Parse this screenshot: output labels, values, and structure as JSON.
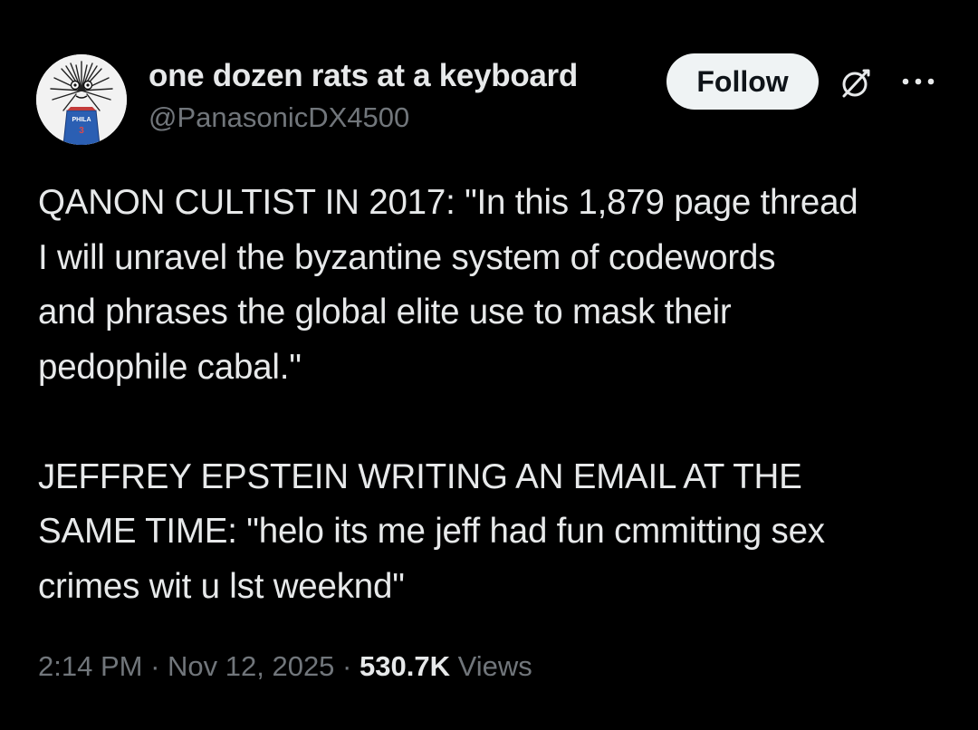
{
  "author": {
    "display_name": "one dozen rats at a keyboard",
    "handle": "@PanasonicDX4500",
    "avatar_icon": "hairy-creature-avatar",
    "avatar_jersey_text": "PHILA"
  },
  "actions": {
    "follow_label": "Follow",
    "grok_icon": "grok-icon",
    "more_icon": "more-dots-icon"
  },
  "tweet": {
    "text": "QANON CULTIST IN 2017: \"In this 1,879 page thread\nI will unravel the byzantine system of codewords\nand phrases the global elite use to mask their\npedophile cabal.\"\n\nJEFFREY EPSTEIN WRITING AN EMAIL AT THE\nSAME TIME: \"helo its me jeff had fun cmmitting sex\ncrimes wit u lst weeknd\""
  },
  "meta": {
    "time": "2:14 PM",
    "separator": " · ",
    "date": "Nov 12, 2025",
    "views_count": "530.7K",
    "views_label": " Views"
  },
  "colors": {
    "background": "#000000",
    "text_primary": "#e7e9ea",
    "text_secondary": "#71767b",
    "follow_bg": "#eff3f4"
  }
}
